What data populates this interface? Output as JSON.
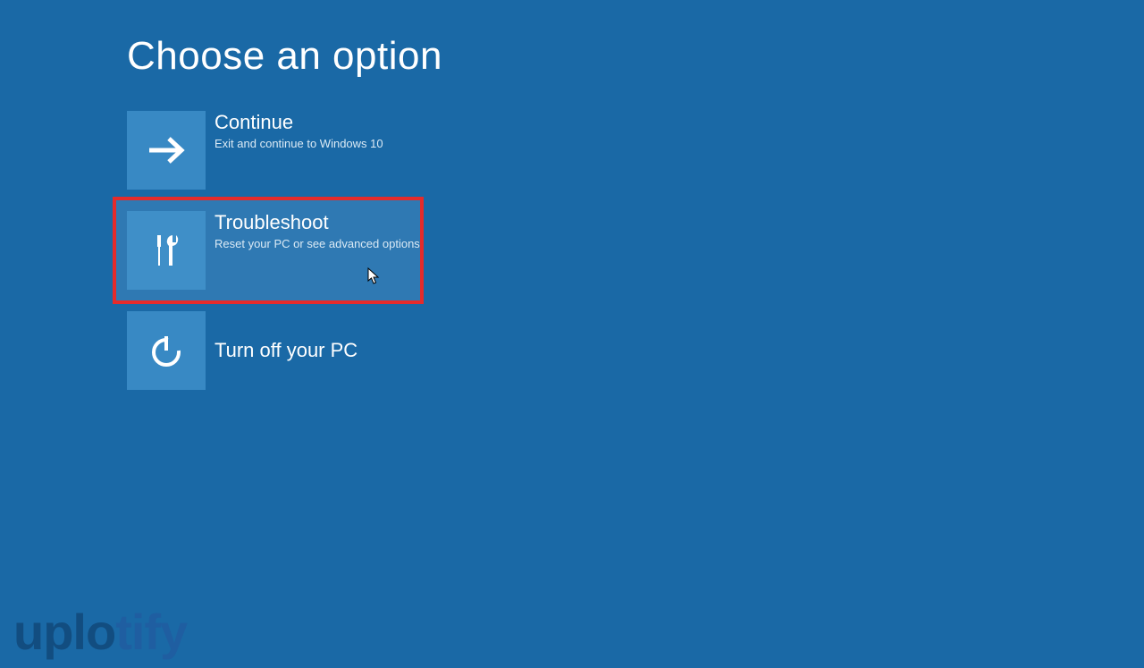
{
  "title": "Choose an option",
  "options": {
    "continue": {
      "title": "Continue",
      "subtitle": "Exit and continue to Windows 10"
    },
    "troubleshoot": {
      "title": "Troubleshoot",
      "subtitle": "Reset your PC or see advanced options"
    },
    "turnoff": {
      "title": "Turn off your PC"
    }
  },
  "watermark": {
    "part1": "uplo",
    "part2": "tify"
  }
}
